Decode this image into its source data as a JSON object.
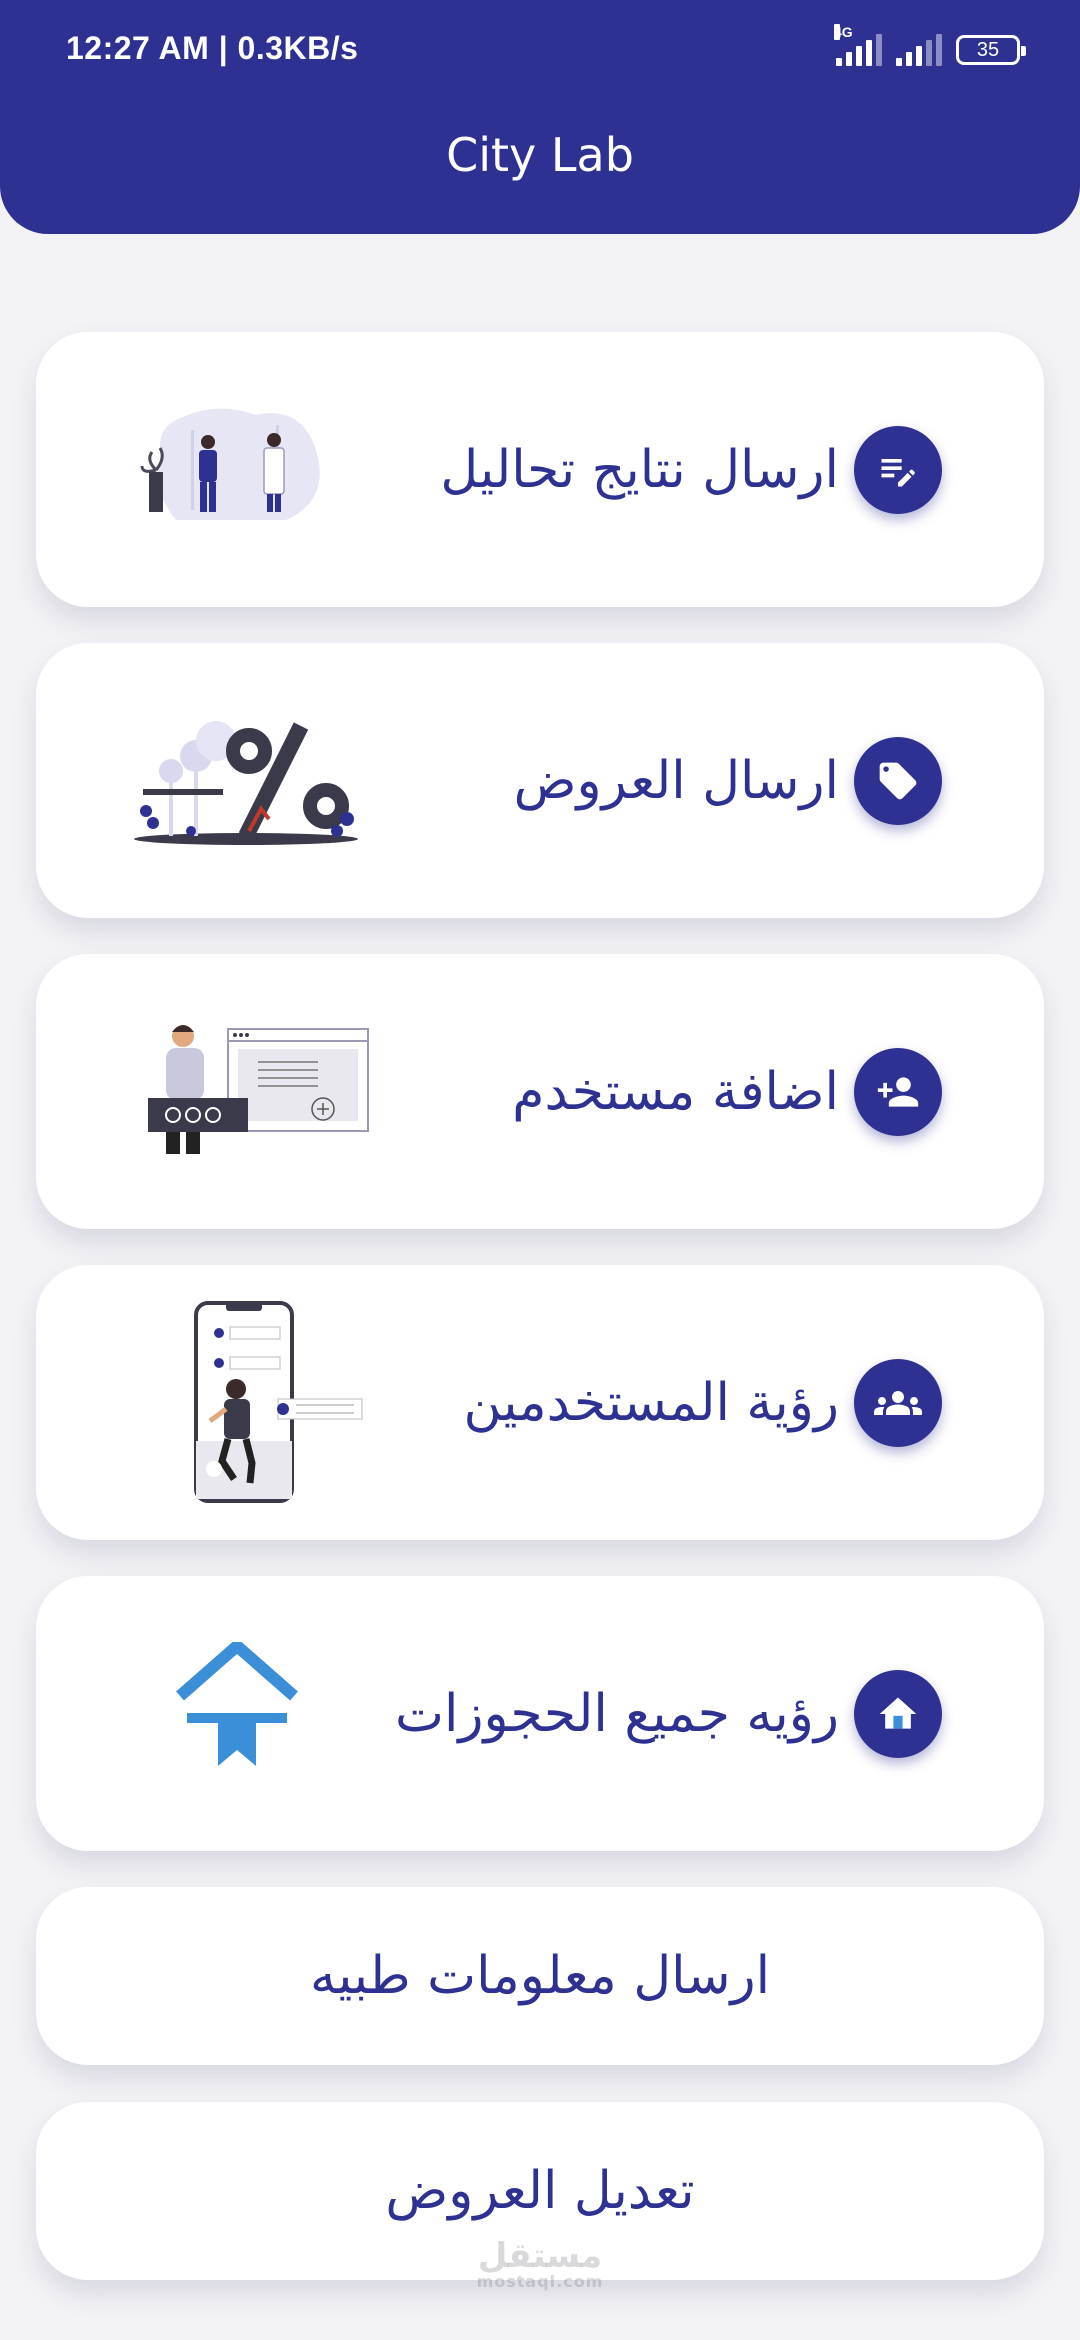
{
  "status_bar": {
    "time": "12:27 AM | 0.3KB/s",
    "network": "4G",
    "battery": "35"
  },
  "header": {
    "title": "City Lab"
  },
  "menu": [
    {
      "label": "ارسال نتايج تحاليل",
      "icon": "edit-note-icon"
    },
    {
      "label": "ارسال العروض",
      "icon": "tag-icon"
    },
    {
      "label": "اضافة مستخدم",
      "icon": "person-add-icon"
    },
    {
      "label": "رؤية المستخدمين",
      "icon": "group-icon"
    },
    {
      "label": "رؤيه جميع الحجوزات",
      "icon": "home-icon"
    },
    {
      "label": "ارسال معلومات طبيه"
    },
    {
      "label": "تعديل العروض"
    }
  ],
  "watermark": {
    "text": "مستقل",
    "sub": "mostaql.com"
  },
  "colors": {
    "primary": "#2e3192",
    "background": "#f3f3f6",
    "card": "#ffffff"
  }
}
